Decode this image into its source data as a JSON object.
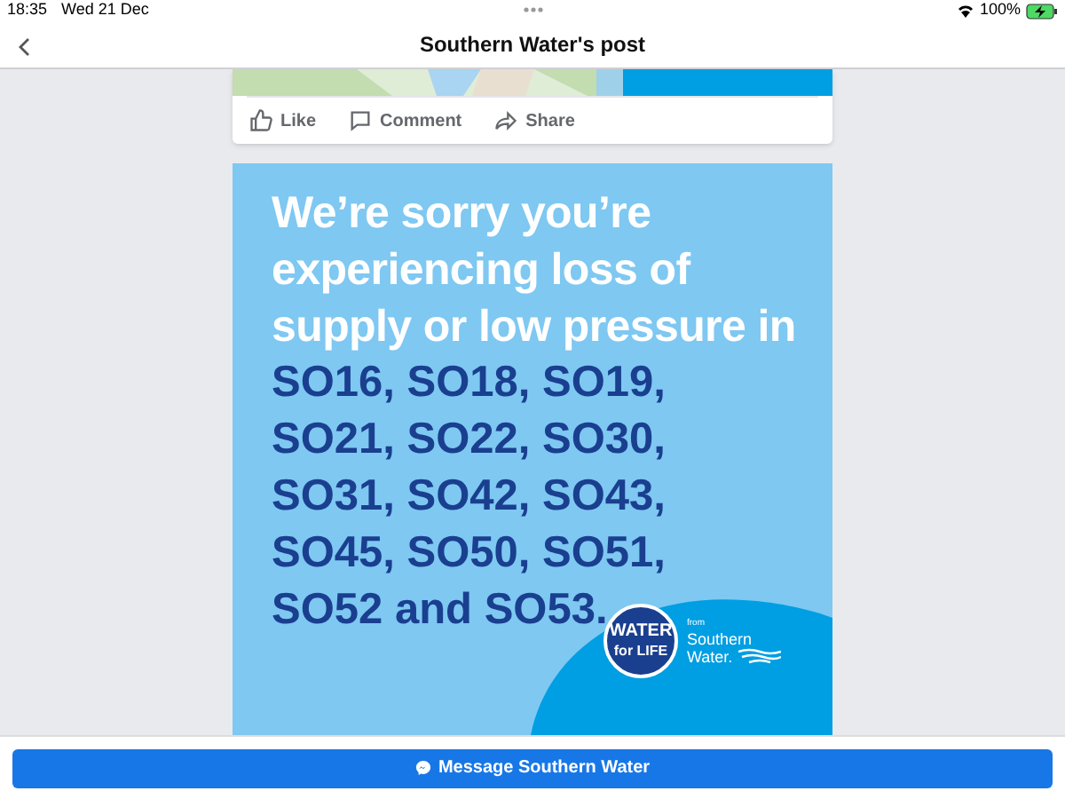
{
  "status_bar": {
    "time": "18:35",
    "date": "Wed 21 Dec",
    "battery": "100%"
  },
  "header": {
    "title": "Southern Water's post"
  },
  "actions": [
    {
      "kind": "like",
      "label": "Like"
    },
    {
      "kind": "comment",
      "label": "Comment"
    },
    {
      "kind": "share",
      "label": "Share"
    }
  ],
  "post_graphic": {
    "headline": "We’re sorry you’re experiencing loss of supply or low pressure in",
    "areas": [
      "SO16, SO18, SO19,",
      "SO21, SO22, SO30,",
      "SO31, SO42, SO43,",
      "SO45, SO50, SO51,",
      "SO52 and SO53."
    ],
    "logo": {
      "line_1": "WATER",
      "line_2": "for LIFE",
      "from": "from",
      "brand_1": "Southern",
      "brand_2": "Water."
    }
  },
  "message_button": {
    "label": "Message Southern Water"
  }
}
